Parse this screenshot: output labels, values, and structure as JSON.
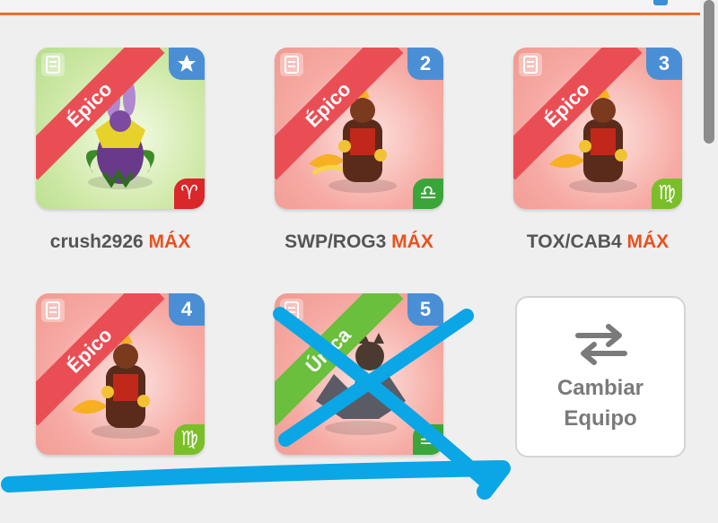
{
  "header": {
    "accent_color": "#e8702a"
  },
  "cards": [
    {
      "rarity": "Épico",
      "badge": "★",
      "badge_icon": "star-icon",
      "zodiac": "♈",
      "name": "crush2926",
      "level_tag": "MÁX"
    },
    {
      "rarity": "Épico",
      "badge": "2",
      "zodiac": "♎",
      "name": "SWP/ROG3",
      "level_tag": "MÁX"
    },
    {
      "rarity": "Épico",
      "badge": "3",
      "zodiac": "♍",
      "name": "TOX/CAB4",
      "level_tag": "MÁX"
    },
    {
      "rarity": "Épico",
      "badge": "4",
      "zodiac": "♍",
      "name": "",
      "level_tag": ""
    },
    {
      "rarity": "Única",
      "badge": "5",
      "zodiac": "♎",
      "name": "",
      "level_tag": ""
    }
  ],
  "switch_team": {
    "line1": "Cambiar",
    "line2": "Equipo",
    "icon": "swap-arrows-icon"
  },
  "annotation": {
    "color": "#0aa6e6",
    "description": "hand-drawn blue cross and underline strokes"
  }
}
